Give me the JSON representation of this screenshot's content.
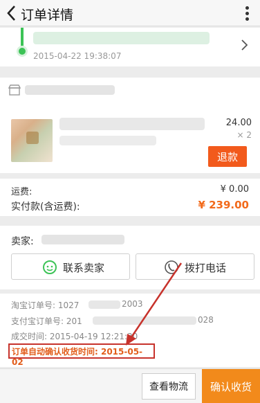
{
  "header": {
    "title": "订单详情"
  },
  "logistics": {
    "time": "2015-04-22 19:38:07"
  },
  "product": {
    "price_fragment": "24.00",
    "qty": "× 2",
    "refund_label": "退款"
  },
  "totals": {
    "shipping_label": "运费:",
    "shipping_value": "¥ 0.00",
    "paid_label": "实付款(含运费):",
    "paid_value": "¥ 239.00"
  },
  "seller": {
    "label": "卖家:",
    "contact_label": "联系卖家",
    "call_label": "拨打电话"
  },
  "order_info": {
    "taobao_no_label": "淘宝订单号: 1027",
    "taobao_no_tail": "2003",
    "alipay_no_label": "支付宝订单号: 201",
    "alipay_no_tail": "028",
    "deal_time": "成交时间: 2015-04-19 12:21:30",
    "auto_confirm": "订单自动确认收货时间: 2015-05-02"
  },
  "bottom_bar": {
    "view_logistics": "查看物流",
    "confirm_receipt": "确认收货"
  },
  "colors": {
    "green": "#3cc356",
    "orange": "#f26a1b",
    "refund": "#f25a1c",
    "annotation_red": "#c7322b"
  }
}
